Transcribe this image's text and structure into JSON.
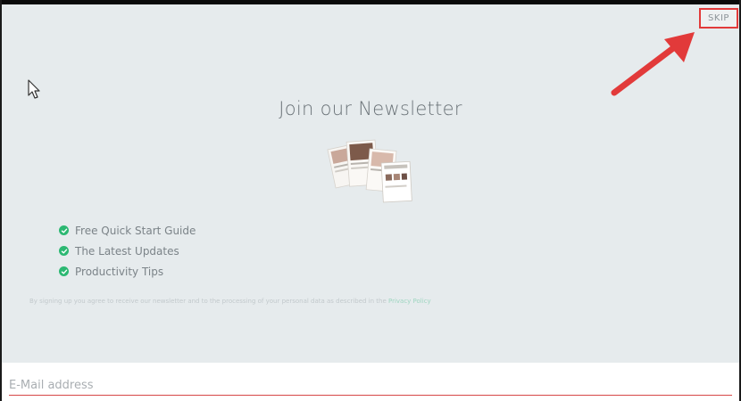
{
  "modal": {
    "skip_label": "SKIP",
    "title": "Join our Newsletter",
    "features": [
      {
        "label": "Free Quick Start Guide",
        "icon": "check-circle-icon"
      },
      {
        "label": "The Latest Updates",
        "icon": "check-circle-icon"
      },
      {
        "label": "Productivity Tips",
        "icon": "check-circle-icon"
      }
    ],
    "fine_print": "By signing up you agree to receive our newsletter and to the processing of your personal data as described in the ",
    "fine_print_link": "Privacy Policy"
  },
  "email": {
    "placeholder": "E-Mail address",
    "value": ""
  },
  "colors": {
    "background": "#e6ebed",
    "check_green": "#2cb872",
    "highlight_red": "#e23a3a",
    "underline_red": "#d64747"
  }
}
